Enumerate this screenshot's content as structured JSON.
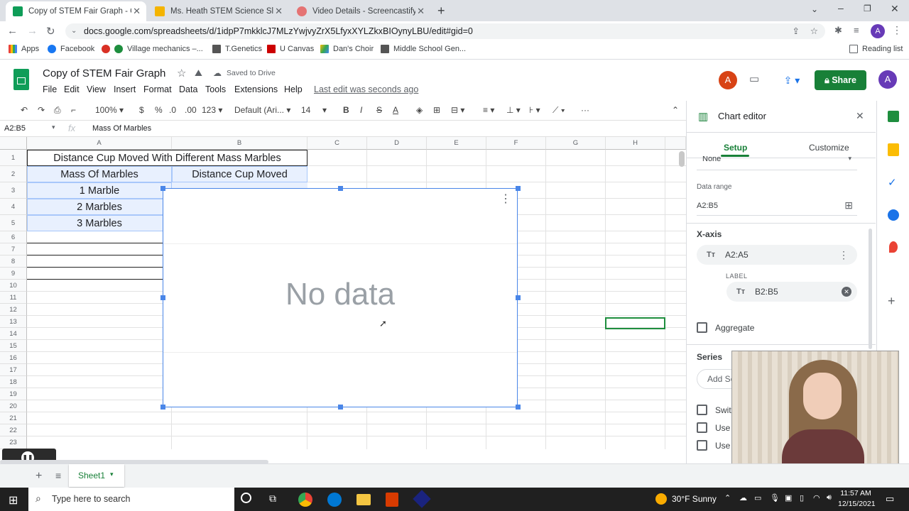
{
  "browser": {
    "tabs": [
      {
        "label": "Copy of STEM Fair Graph - Goog",
        "active": true
      },
      {
        "label": "Ms. Heath STEM Science Slides -",
        "active": false
      },
      {
        "label": "Video Details - Screencastify",
        "active": false
      }
    ],
    "url": "docs.google.com/spreadsheets/d/1idpP7mkklcJ7MLzYwjvyZrX5LfyxXYLZkxBIOynyLBU/edit#gid=0",
    "bookmarks": [
      "Apps",
      "Facebook",
      "Village mechanics –...",
      "T.Genetics",
      "U Canvas",
      "Dan's Choir",
      "Middle School Gen..."
    ],
    "reading_list": "Reading list"
  },
  "doc": {
    "title": "Copy of STEM Fair Graph",
    "saved_status": "Saved to Drive",
    "menus": [
      "File",
      "Edit",
      "View",
      "Insert",
      "Format",
      "Data",
      "Tools",
      "Extensions",
      "Help"
    ],
    "last_edit": "Last edit was seconds ago",
    "share_label": "Share",
    "avatar_letter": "A"
  },
  "toolbar": {
    "zoom": "100%",
    "currency": "$",
    "percent": "%",
    "dec_less": ".0",
    "dec_more": ".00",
    "format_more": "123",
    "font": "Default (Ari...",
    "font_size": "14"
  },
  "formula": {
    "cell_ref": "A2:B5",
    "fx": "fx",
    "value": "Mass Of Marbles"
  },
  "grid": {
    "columns": [
      "A",
      "B",
      "C",
      "D",
      "E",
      "F",
      "G",
      "H"
    ],
    "rows": [
      "1",
      "2",
      "3",
      "4",
      "5",
      "6",
      "7",
      "8",
      "9",
      "10",
      "11",
      "12",
      "13",
      "14",
      "15",
      "16",
      "17",
      "18",
      "19",
      "20",
      "21",
      "22",
      "23"
    ],
    "title_cell": "Distance Cup Moved With Different Mass Marbles",
    "header_a": "Mass Of Marbles",
    "header_b": "Distance Cup Moved",
    "a3": "1 Marble",
    "a4": "2 Marbles",
    "a5": "3 Marbles"
  },
  "chart": {
    "placeholder": "No data"
  },
  "editor": {
    "title": "Chart editor",
    "tab_setup": "Setup",
    "tab_customize": "Customize",
    "dropdown_value": "None",
    "data_range_label": "Data range",
    "data_range_value": "A2:B5",
    "xaxis_label": "X-axis",
    "xaxis_value": "A2:A5",
    "label_label": "LABEL",
    "label_value": "B2:B5",
    "aggregate": "Aggregate",
    "series_label": "Series",
    "add_series": "Add Se",
    "opt1": "Swit",
    "opt2": "Use",
    "opt3": "Use"
  },
  "sheet": {
    "tab_name": "Sheet1"
  },
  "taskbar": {
    "search_placeholder": "Type here to search",
    "weather": "30°F  Sunny",
    "time": "11:57 AM",
    "date": "12/15/2021"
  },
  "colors": {
    "sheets_green": "#0f9d58",
    "selection_blue": "#4a86e8",
    "share_green": "#188038"
  }
}
